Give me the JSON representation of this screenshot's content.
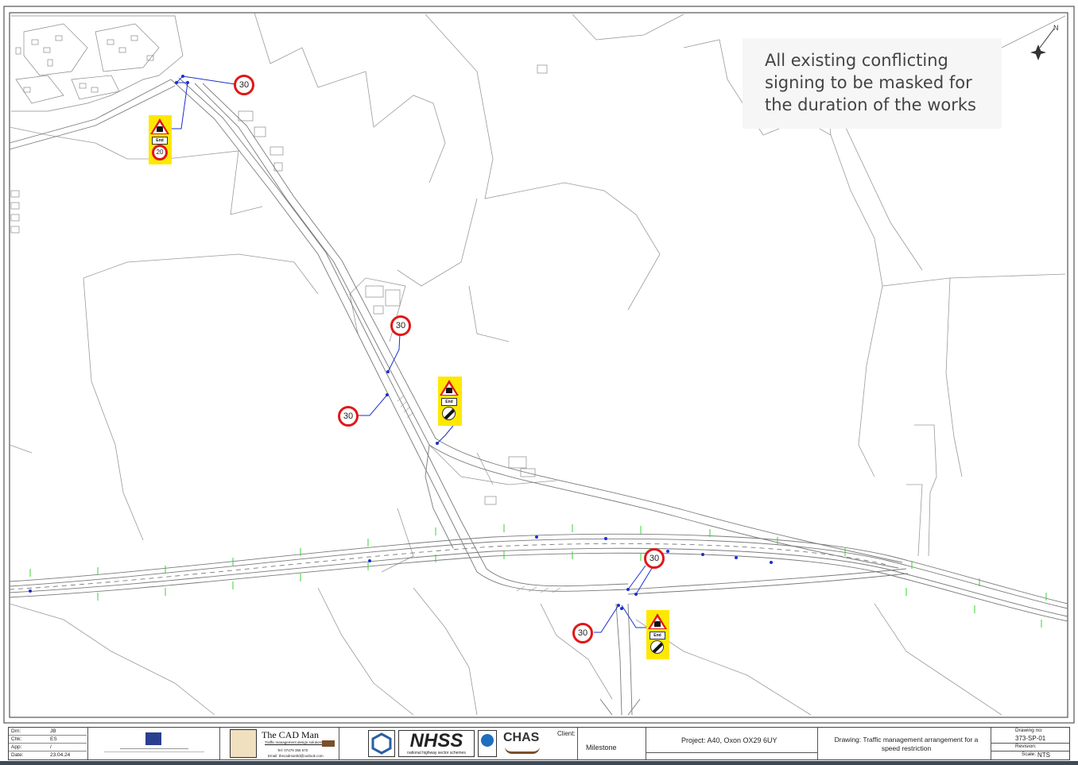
{
  "note": {
    "lines": [
      "All existing conflicting",
      "signing to be masked for",
      "the duration of the works"
    ]
  },
  "speed_signs": [
    {
      "value": "30",
      "label": "speed-limit-30-north"
    },
    {
      "value": "30",
      "label": "speed-limit-30-farm"
    },
    {
      "value": "30",
      "label": "speed-limit-30-west"
    },
    {
      "value": "30",
      "label": "speed-limit-30-a40"
    },
    {
      "value": "30",
      "label": "speed-limit-30-south"
    }
  ],
  "works_signs": [
    {
      "plate": "End",
      "sub": "20"
    },
    {
      "plate": "End",
      "sub": "national-speed-limit"
    },
    {
      "plate": "End",
      "sub": "national-speed-limit"
    }
  ],
  "north_arrow": {
    "letter": "N"
  },
  "title_block": {
    "drn_label": "Drn:",
    "drn": "JB",
    "chk_label": "Chk:",
    "chk": "ES",
    "app_label": "App:",
    "app": "/",
    "date_label": "Date:",
    "date": "23.04.24",
    "company": "The CAD Man",
    "company_tagline": "Traffic management design solutions",
    "company_tel": "Tel: 07479 356 670",
    "company_email": "Email: thecadmanltd@outlook.com",
    "nhss_text": "NHSS",
    "nhss_sub": "national highway sector schemes",
    "chas_text": "CHAS",
    "client_label": "Client:",
    "client": "Milestone",
    "project": "Project:  A40, Oxon OX29 6UY",
    "drawing": "Drawing: Traffic management arrangement for a speed restriction",
    "drawing_no_label": "Drawing no:",
    "drawing_no": "373-SP-01",
    "revision_label": "Revision:",
    "revision": "",
    "scale_label": "Scale:",
    "scale": "NTS"
  },
  "colors": {
    "speed_ring": "#e01818",
    "sign_backing": "#ffe800",
    "sign_lead": "#1a2fd0",
    "cone": "#39d139",
    "linework": "#8a8a8a"
  }
}
